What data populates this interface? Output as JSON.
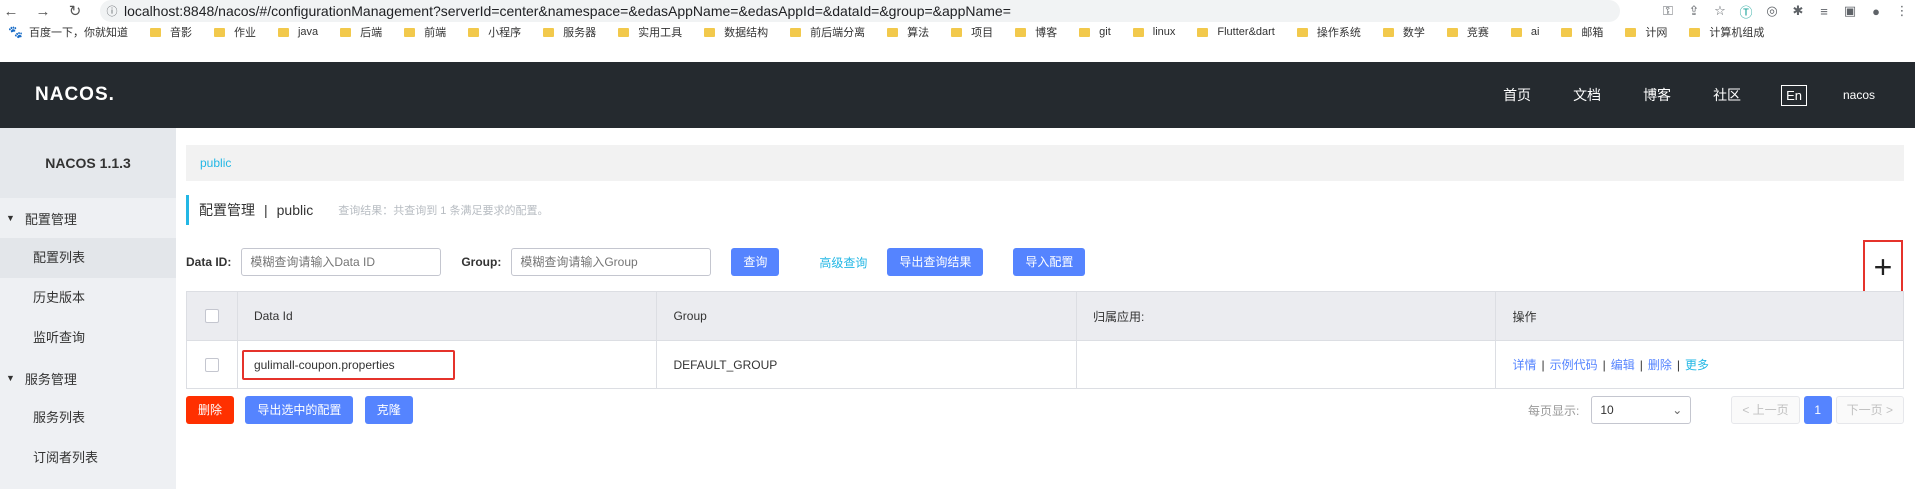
{
  "browser": {
    "url": "localhost:8848/nacos/#/configurationManagement?serverId=center&namespace=&edasAppName=&edasAppId=&dataId=&group=&appName="
  },
  "bookmarks": [
    {
      "label": "百度一下，你就知道",
      "type": "paw"
    },
    {
      "label": "音影",
      "type": "folder"
    },
    {
      "label": "作业",
      "type": "folder"
    },
    {
      "label": "java",
      "type": "folder"
    },
    {
      "label": "后端",
      "type": "folder"
    },
    {
      "label": "前端",
      "type": "folder"
    },
    {
      "label": "小程序",
      "type": "folder"
    },
    {
      "label": "服务器",
      "type": "folder"
    },
    {
      "label": "实用工具",
      "type": "folder"
    },
    {
      "label": "数据结构",
      "type": "folder"
    },
    {
      "label": "前后端分离",
      "type": "folder"
    },
    {
      "label": "算法",
      "type": "folder"
    },
    {
      "label": "项目",
      "type": "folder"
    },
    {
      "label": "博客",
      "type": "folder"
    },
    {
      "label": "git",
      "type": "folder"
    },
    {
      "label": "linux",
      "type": "folder"
    },
    {
      "label": "Flutter&dart",
      "type": "folder"
    },
    {
      "label": "操作系统",
      "type": "folder"
    },
    {
      "label": "数学",
      "type": "folder"
    },
    {
      "label": "竞赛",
      "type": "folder"
    },
    {
      "label": "ai",
      "type": "folder"
    },
    {
      "label": "邮箱",
      "type": "folder"
    },
    {
      "label": "计网",
      "type": "folder"
    },
    {
      "label": "计算机组成",
      "type": "folder"
    }
  ],
  "header": {
    "logo": "NACOS.",
    "nav": [
      "首页",
      "文档",
      "博客",
      "社区"
    ],
    "lang": "En",
    "user": "nacos"
  },
  "sidebar": {
    "title": "NACOS 1.1.3",
    "groups": [
      {
        "label": "配置管理",
        "items": [
          "配置列表",
          "历史版本",
          "监听查询"
        ]
      },
      {
        "label": "服务管理",
        "items": [
          "服务列表",
          "订阅者列表"
        ]
      }
    ]
  },
  "main": {
    "breadcrumb": "public",
    "title": "配置管理",
    "separator": "|",
    "namespace": "public",
    "result": "查询结果：共查询到 1 条满足要求的配置。",
    "filters": {
      "dataid_label": "Data ID:",
      "dataid_placeholder": "模糊查询请输入Data ID",
      "group_label": "Group:",
      "group_placeholder": "模糊查询请输入Group",
      "query_btn": "查询",
      "advanced": "高级查询",
      "export_btn": "导出查询结果",
      "import_btn": "导入配置"
    },
    "add_symbol": "+",
    "table": {
      "headers": [
        "Data Id",
        "Group",
        "归属应用:",
        "操作"
      ],
      "rows": [
        {
          "data_id": "gulimall-coupon.properties",
          "group": "DEFAULT_GROUP",
          "app": ""
        }
      ],
      "ops": [
        "详情",
        "示例代码",
        "编辑",
        "删除"
      ],
      "more": "更多",
      "op_sep": "|"
    },
    "bottom": {
      "delete_btn": "删除",
      "export_selected_btn": "导出选中的配置",
      "clone_btn": "克隆",
      "page_size_label": "每页显示:",
      "page_size": "10",
      "prev": "< 上一页",
      "page": "1",
      "next": "下一页 >"
    }
  },
  "colors": {
    "header_bg": "#252a2f",
    "primary": "#5584ff",
    "accent_link": "#23b7e5",
    "danger": "#ff3000",
    "highlight_box": "#e5322b"
  }
}
